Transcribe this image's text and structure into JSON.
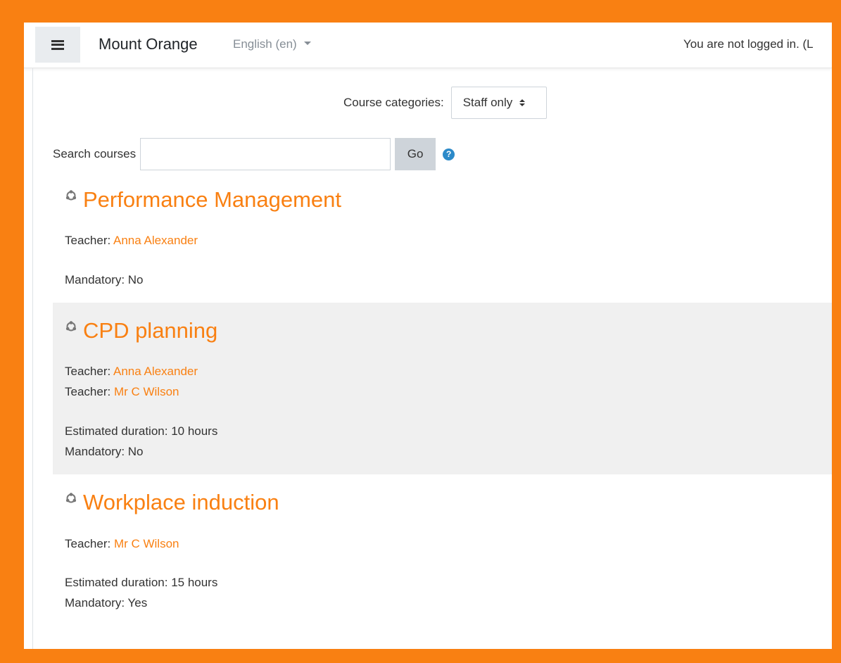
{
  "header": {
    "site_name": "Mount Orange",
    "language": "English (en)",
    "login_text": "You are not logged in. (L"
  },
  "filters": {
    "category_label": "Course categories:",
    "category_value": "Staff only",
    "search_label": "Search courses",
    "search_value": "",
    "go_label": "Go",
    "help_glyph": "?"
  },
  "courses": [
    {
      "title": "Performance Management",
      "teachers": [
        {
          "label": "Teacher:",
          "name": "Anna Alexander"
        }
      ],
      "mandatory": "Mandatory: No"
    },
    {
      "title": "CPD planning",
      "teachers": [
        {
          "label": "Teacher:",
          "name": "Anna Alexander"
        },
        {
          "label": "Teacher:",
          "name": "Mr C Wilson"
        }
      ],
      "duration": "Estimated duration: 10 hours",
      "mandatory": "Mandatory: No"
    },
    {
      "title": "Workplace induction",
      "teachers": [
        {
          "label": "Teacher:",
          "name": "Mr C Wilson"
        }
      ],
      "duration": "Estimated duration: 15 hours",
      "mandatory": "Mandatory: Yes"
    }
  ],
  "colors": {
    "brand": "#f98012",
    "help": "#2c8ac9",
    "alt_row": "#f0f0f0"
  },
  "icons": {
    "menu": "hamburger-icon",
    "language": "caret-down-icon",
    "select": "sort-icon",
    "help": "question-circle-icon",
    "course": "course-icon"
  }
}
